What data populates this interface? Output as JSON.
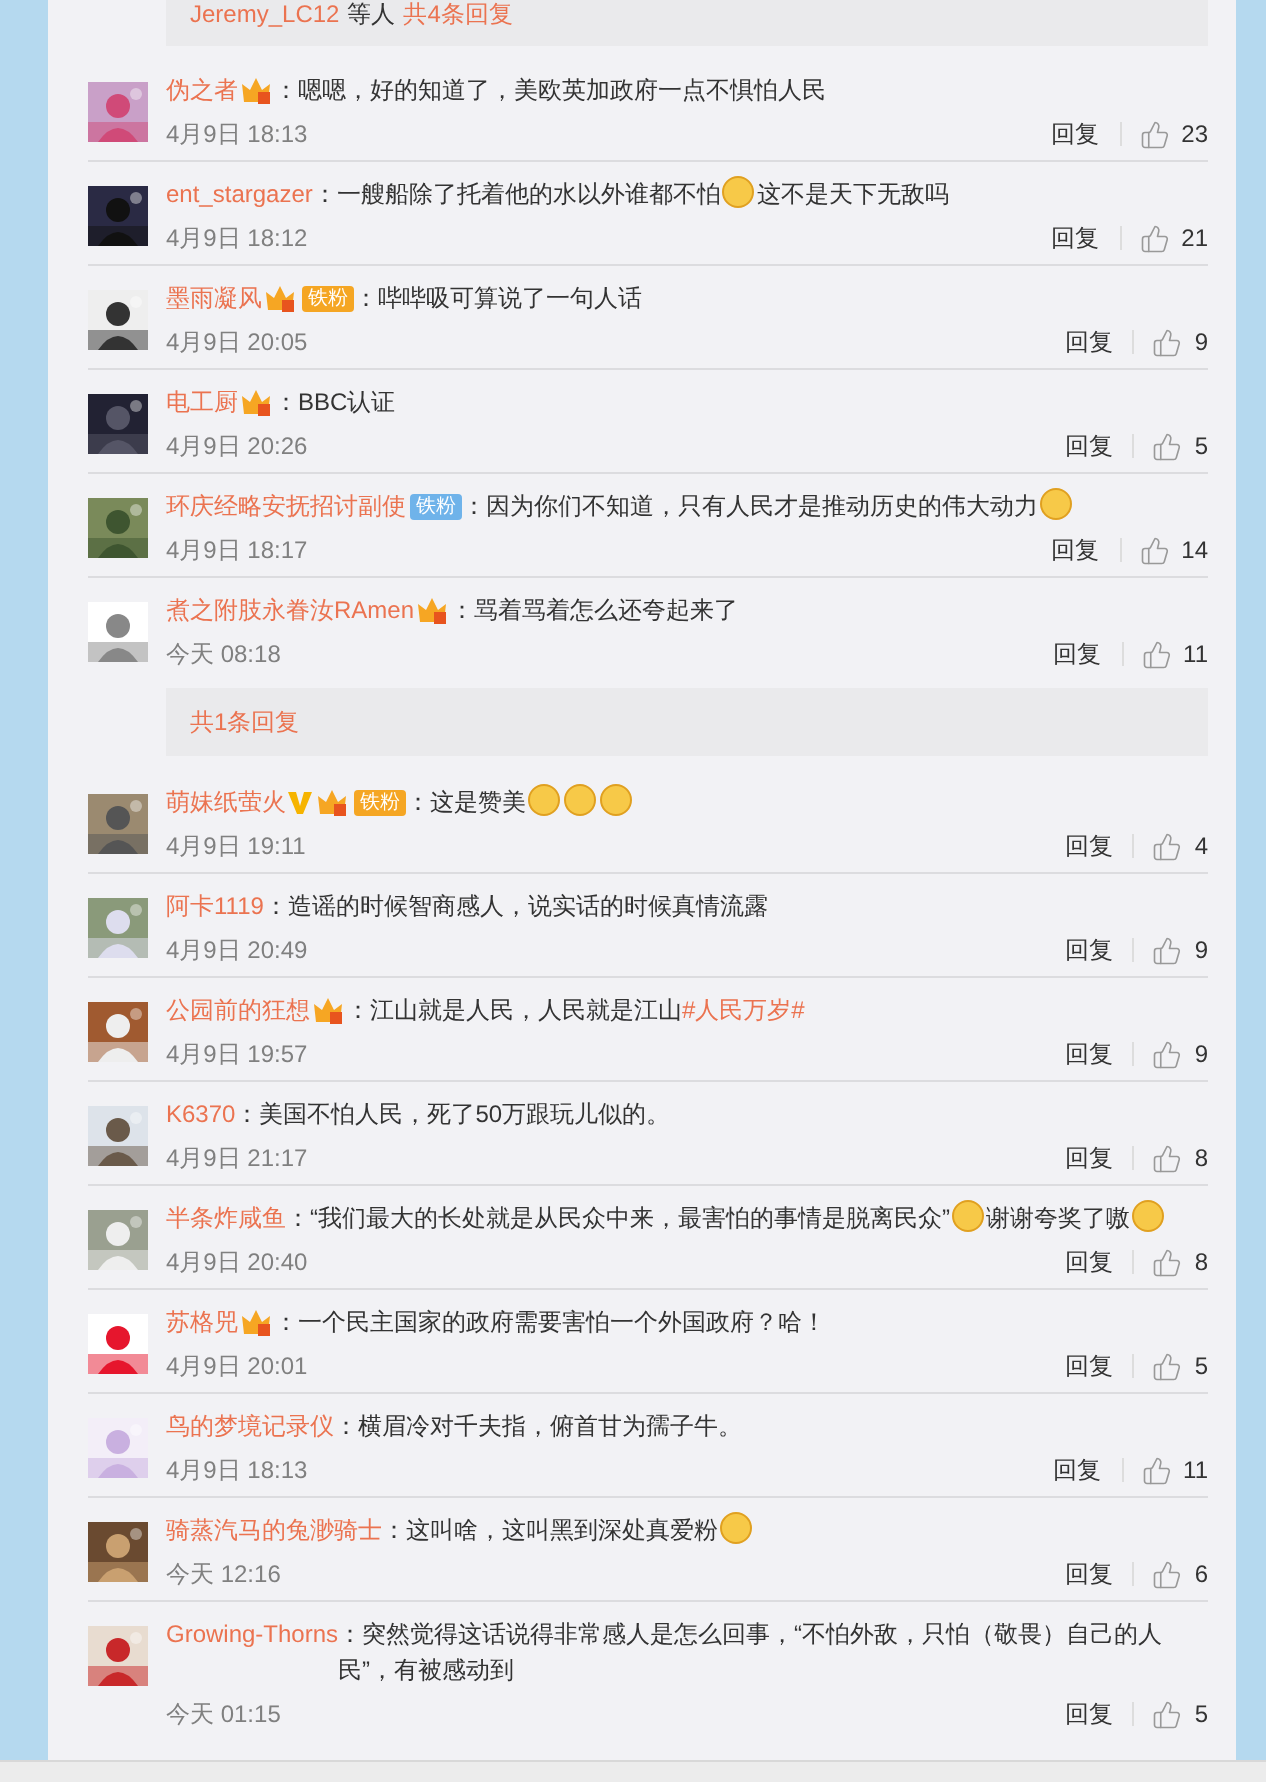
{
  "thread_above": {
    "users": "Jeremy_LC12",
    "suffix": "等人",
    "link": "共4条回复"
  },
  "comments": [
    {
      "name": "伪之者",
      "badges": [
        {
          "kind": "member"
        }
      ],
      "content": [
        {
          "kind": "text",
          "text": "：嗯嗯，好的知道了，美欧英加政府一点不惧怕人民"
        }
      ],
      "time": "4月9日 18:13",
      "reply": "回复",
      "likes": "23"
    },
    {
      "name": "ent_stargazer",
      "content": [
        {
          "kind": "text",
          "text": "：一艘船除了托着他的水以外谁都不怕"
        },
        {
          "kind": "emoji"
        },
        {
          "kind": "text",
          "text": "这不是天下无敌吗"
        }
      ],
      "time": "4月9日 18:12",
      "reply": "回复",
      "likes": "21"
    },
    {
      "name": "墨雨凝风",
      "badges": [
        {
          "kind": "member"
        },
        {
          "kind": "fan",
          "text": "铁粉",
          "color": "#f5a623"
        }
      ],
      "content": [
        {
          "kind": "text",
          "text": "：哔哔吸可算说了一句人话"
        }
      ],
      "time": "4月9日 20:05",
      "reply": "回复",
      "likes": "9"
    },
    {
      "name": "电工厨",
      "badges": [
        {
          "kind": "member"
        }
      ],
      "content": [
        {
          "kind": "text",
          "text": "：BBC认证"
        }
      ],
      "time": "4月9日 20:26",
      "reply": "回复",
      "likes": "5"
    },
    {
      "name": "环庆经略安抚招讨副使",
      "badges": [
        {
          "kind": "fan",
          "text": "铁粉",
          "color": "#6fb3ea"
        }
      ],
      "content": [
        {
          "kind": "text",
          "text": "：因为你们不知道，只有人民才是推动历史的伟大动力"
        },
        {
          "kind": "emoji"
        }
      ],
      "time": "4月9日 18:17",
      "reply": "回复",
      "likes": "14"
    },
    {
      "name": "煮之附肢永眷汝RAmen",
      "badges": [
        {
          "kind": "member"
        }
      ],
      "content": [
        {
          "kind": "text",
          "text": "：骂着骂着怎么还夸起来了"
        }
      ],
      "time": "今天 08:18",
      "reply": "回复",
      "likes": "11",
      "thread": {
        "link": "共1条回复"
      }
    },
    {
      "name": "萌妹纸萤火",
      "badges": [
        {
          "kind": "verified"
        },
        {
          "kind": "member"
        },
        {
          "kind": "fan",
          "text": "铁粉",
          "color": "#f5a623"
        }
      ],
      "content": [
        {
          "kind": "text",
          "text": "：这是赞美"
        },
        {
          "kind": "emoji"
        },
        {
          "kind": "emoji"
        },
        {
          "kind": "emoji"
        }
      ],
      "time": "4月9日 19:11",
      "reply": "回复",
      "likes": "4"
    },
    {
      "name": "阿卡1119",
      "content": [
        {
          "kind": "text",
          "text": "：造谣的时候智商感人，说实话的时候真情流露"
        }
      ],
      "time": "4月9日 20:49",
      "reply": "回复",
      "likes": "9"
    },
    {
      "name": "公园前的狂想",
      "badges": [
        {
          "kind": "member"
        }
      ],
      "content": [
        {
          "kind": "text",
          "text": "：江山就是人民，人民就是江山"
        },
        {
          "kind": "topic",
          "text": "#人民万岁#"
        }
      ],
      "time": "4月9日 19:57",
      "reply": "回复",
      "likes": "9"
    },
    {
      "name": "K6370",
      "content": [
        {
          "kind": "text",
          "text": "：美国不怕人民，死了50万跟玩儿似的。"
        }
      ],
      "time": "4月9日 21:17",
      "reply": "回复",
      "likes": "8"
    },
    {
      "name": "半条炸咸鱼",
      "content": [
        {
          "kind": "text",
          "text": "：“我们最大的长处就是从民众中来，最害怕的事情是脱离民众”"
        },
        {
          "kind": "emoji"
        },
        {
          "kind": "text",
          "text": "谢谢夸奖了嗷"
        },
        {
          "kind": "emoji"
        }
      ],
      "time": "4月9日 20:40",
      "reply": "回复",
      "likes": "8"
    },
    {
      "name": "苏格兕",
      "badges": [
        {
          "kind": "member"
        }
      ],
      "content": [
        {
          "kind": "text",
          "text": "：一个民主国家的政府需要害怕一个外国政府？哈！"
        }
      ],
      "time": "4月9日 20:01",
      "reply": "回复",
      "likes": "5"
    },
    {
      "name": "鸟的梦境记录仪",
      "content": [
        {
          "kind": "text",
          "text": "：横眉冷对千夫指，俯首甘为孺子牛。"
        }
      ],
      "time": "4月9日 18:13",
      "reply": "回复",
      "likes": "11"
    },
    {
      "name": "骑蒸汽马的兔渺骑士",
      "content": [
        {
          "kind": "text",
          "text": "：这叫啥，这叫黑到深处真爱粉"
        },
        {
          "kind": "emoji"
        }
      ],
      "time": "今天 12:16",
      "reply": "回复",
      "likes": "6"
    },
    {
      "name": "Growing-Thorns",
      "content": [
        {
          "kind": "text",
          "text": "：突然觉得这话说得非常感人是怎么回事，“不怕外敌，只怕（敬畏）自己的人民”，有被感动到"
        }
      ],
      "time": "今天 01:15",
      "reply": "回复",
      "likes": "5"
    }
  ]
}
